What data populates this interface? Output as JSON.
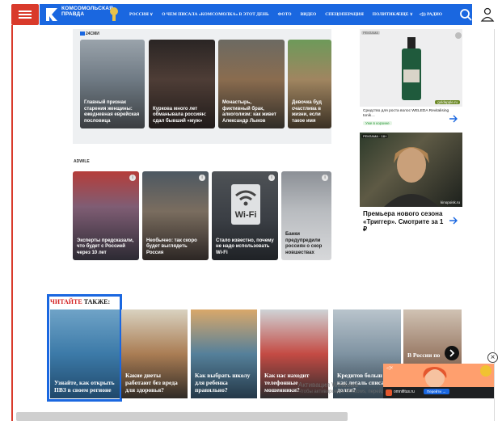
{
  "colors": {
    "brand_red": "#d93a2b",
    "brand_blue": "#1a67e0",
    "read_also_red": "#d31f1f"
  },
  "header": {
    "logo_line1": "КОМСОМОЛЬСКАЯ",
    "logo_line2": "ПРАВДА",
    "nav_items": [
      "РОССИЯ ∨",
      "О ЧЕМ ПИСАЛА «КОМСОМОЛКА» В ЭТОТ ДЕНЬ",
      "ФОТО",
      "ВИДЕО",
      "СПЕЦОПЕРАЦИЯ",
      "ПОЛИТИКА"
    ],
    "more_label": "ЕЩЕ ∨",
    "radio_label": "РАДИО",
    "icons": [
      "menu-icon",
      "search-icon",
      "user-icon"
    ]
  },
  "block1": {
    "brand": "24СМИ",
    "cards": [
      "Главный признак старения женщины: ежедневная еврейская пословица",
      "Куркова много лет обманывала россиян: сдал бывший «муж»",
      "Монастырь, фиктивный брак, алкоголизм: как живет Александр Лыков",
      "Девочка буд счастлива в жизни, если такое имя"
    ]
  },
  "block2": {
    "brand": "ADWILE",
    "cards": [
      "Эксперты предсказали, что будет с Россией через 10 лет",
      "Необычно: так скоро будет выглядеть Россия",
      "Стало известно, почему не надо использовать Wi-Fi",
      "Банки предупредили россиян о скор новшествах"
    ],
    "wifi_text": "Wi-Fi"
  },
  "ads": {
    "ad1": {
      "badge": "РЕКЛАМА",
      "source": "goldapple.ru",
      "title": "Средство для роста волос WELEDA Revitalising tonik…",
      "stock": "Уже в корзине"
    },
    "ad2": {
      "badge": "РЕКЛАМА · 18+",
      "source": "kinopoisk.ru",
      "title": "Премьера нового сезона «Триггер». Смотрите за 1 ₽"
    }
  },
  "read_also": {
    "title_red": "ЧИТАЙТЕ",
    "title_black": " ТАКЖЕ:",
    "cards": [
      "Узнайте, как открыть ПВЗ в своем регионе",
      "Какие диеты работают без вреда для здоровья?",
      "Как выбрать школу для ребенка правильно?",
      "Как нас находит телефонные мошенники?",
      "Кредитов больш нет: как легаль списать долги?",
      "В России по"
    ]
  },
  "popup_ad": {
    "site": "omnifitus.ru",
    "cta": "Перейти →",
    "close": "×"
  },
  "watermark": {
    "line1": "Активация Windows",
    "line2": "Чтобы активировать Windows, перейдите в раздел \"Параметры\"."
  }
}
